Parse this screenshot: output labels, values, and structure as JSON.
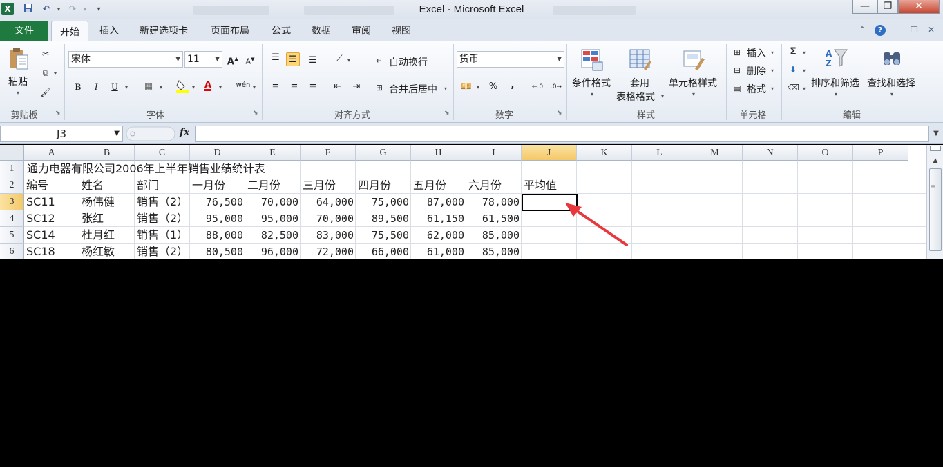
{
  "window": {
    "title": "Excel - Microsoft Excel",
    "logo": "X",
    "minimize": "—",
    "maximize": "❐",
    "close": "✕"
  },
  "quick_access": {
    "save_icon": "save-icon",
    "undo_icon": "undo-icon",
    "redo_icon": "redo-icon"
  },
  "tabs": {
    "file": "文件",
    "home": "开始",
    "insert": "插入",
    "new_tab": "新建选项卡",
    "page_layout": "页面布局",
    "formulas": "公式",
    "data": "数据",
    "review": "审阅",
    "view": "视图"
  },
  "ribbon": {
    "clipboard": {
      "paste": "粘贴",
      "group": "剪贴板"
    },
    "font": {
      "name": "宋体",
      "size": "11",
      "bold": "B",
      "italic": "I",
      "underline": "U",
      "grow": "A",
      "shrink": "A",
      "font_color_glyph": "A",
      "phonetic": "wén",
      "group": "字体"
    },
    "alignment": {
      "wrap_text": "自动换行",
      "merge_center": "合并后居中",
      "group": "对齐方式"
    },
    "number": {
      "format": "货币",
      "percent": "%",
      "comma": ",",
      "group": "数字"
    },
    "styles": {
      "conditional": "条件格式",
      "table_format_1": "套用",
      "table_format_2": "表格格式",
      "cell_styles": "单元格样式",
      "group": "样式"
    },
    "cells": {
      "insert": "插入",
      "delete": "删除",
      "format": "格式",
      "group": "单元格"
    },
    "editing": {
      "sigma": "Σ",
      "sort_filter": "排序和筛选",
      "find_select": "查找和选择",
      "group": "编辑"
    }
  },
  "formula_bar": {
    "name_box": "J3",
    "fx": "fx",
    "formula": ""
  },
  "sheet": {
    "columns": [
      "A",
      "B",
      "C",
      "D",
      "E",
      "F",
      "G",
      "H",
      "I",
      "J",
      "K",
      "L",
      "M",
      "N",
      "O",
      "P"
    ],
    "selected_column": "J",
    "rows": [
      "1",
      "2",
      "3",
      "4",
      "5",
      "6"
    ],
    "selected_row": "3",
    "title": "通力电器有限公司2006年上半年销售业绩统计表",
    "headers": [
      "编号",
      "姓名",
      "部门",
      "一月份",
      "二月份",
      "三月份",
      "四月份",
      "五月份",
      "六月份",
      "平均值"
    ],
    "data": [
      [
        "SC11",
        "杨伟健",
        "销售（2）",
        "76,500",
        "70,000",
        "64,000",
        "75,000",
        "87,000",
        "78,000"
      ],
      [
        "SC12",
        "张红",
        "销售（2）",
        "95,000",
        "95,000",
        "70,000",
        "89,500",
        "61,150",
        "61,500"
      ],
      [
        "SC14",
        "杜月红",
        "销售（1）",
        "88,000",
        "82,500",
        "83,000",
        "75,500",
        "62,000",
        "85,000"
      ],
      [
        "SC18",
        "杨红敏",
        "销售（2）",
        "80,500",
        "96,000",
        "72,000",
        "66,000",
        "61,000",
        "85,000"
      ]
    ]
  },
  "colors": {
    "file_tab": "#1f7a3f",
    "selection_header": "#f4c867",
    "annotation_arrow": "#e8383d"
  }
}
